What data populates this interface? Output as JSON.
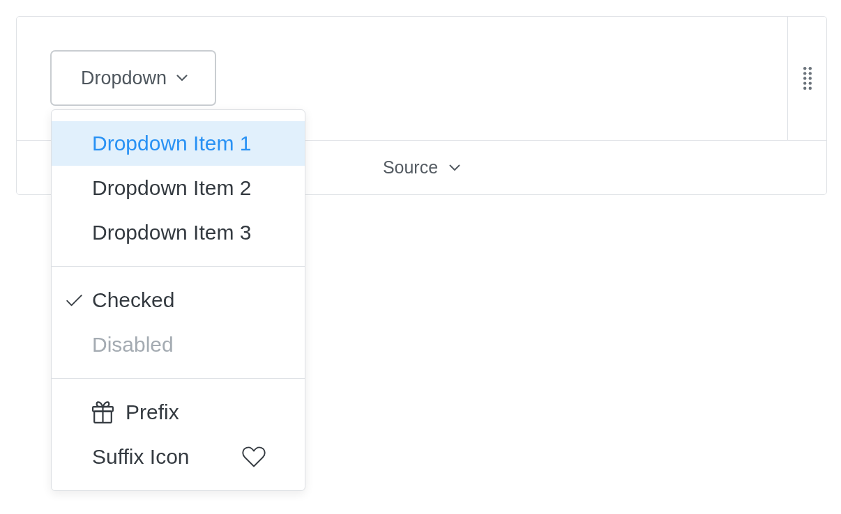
{
  "dropdown_button": {
    "label": "Dropdown"
  },
  "menu": {
    "groups": [
      {
        "items": [
          {
            "kind": "plain",
            "label": "Dropdown Item 1",
            "selected": true,
            "checked": false,
            "disabled": false
          },
          {
            "kind": "plain",
            "label": "Dropdown Item 2",
            "selected": false,
            "checked": false,
            "disabled": false
          },
          {
            "kind": "plain",
            "label": "Dropdown Item 3",
            "selected": false,
            "checked": false,
            "disabled": false
          }
        ]
      },
      {
        "items": [
          {
            "kind": "plain",
            "label": "Checked",
            "selected": false,
            "checked": true,
            "disabled": false
          },
          {
            "kind": "plain",
            "label": "Disabled",
            "selected": false,
            "checked": false,
            "disabled": true
          }
        ]
      },
      {
        "items": [
          {
            "kind": "prefix_icon",
            "label": "Prefix",
            "selected": false,
            "checked": false,
            "disabled": false
          },
          {
            "kind": "suffix_icon",
            "label": "Suffix Icon",
            "selected": false,
            "checked": false,
            "disabled": false
          }
        ]
      }
    ]
  },
  "source_bar": {
    "label": "Source"
  }
}
